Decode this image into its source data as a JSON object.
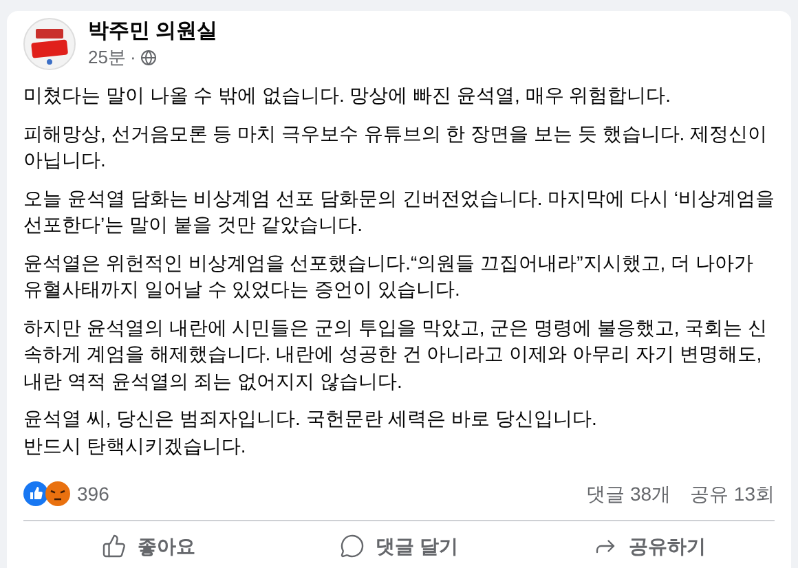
{
  "post": {
    "author": "박주민 의원실",
    "time": "25분",
    "separator": "·",
    "paragraphs": [
      {
        "lines": [
          "미쳤다는 말이 나올 수 밖에 없습니다. 망상에 빠진 윤석열, 매우 위험합니다."
        ]
      },
      {
        "lines": [
          "피해망상, 선거음모론 등 마치 극우보수 유튜브의 한 장면을 보는 듯 했습니다. 제정신이 아닙니다."
        ]
      },
      {
        "lines": [
          "오늘 윤석열 담화는 비상계엄 선포 담화문의 긴버전었습니다. 마지막에 다시 ‘비상계엄을 선포한다’는 말이 붙을 것만 같았습니다."
        ]
      },
      {
        "lines": [
          "윤석열은 위헌적인 비상계엄을 선포했습니다.“의원들 끄집어내라”지시했고, 더 나아가 유혈사태까지 일어날 수 있었다는 증언이 있습니다."
        ]
      },
      {
        "lines": [
          "하지만 윤석열의 내란에 시민들은 군의 투입을 막았고, 군은 명령에 불응했고, 국회는 신속하게 계엄을 해제했습니다. 내란에 성공한 건 아니라고 이제와 아무리 자기 변명해도, 내란 역적 윤석열의 죄는 없어지지 않습니다."
        ]
      },
      {
        "lines": [
          "윤석열 씨, 당신은 범죄자입니다. 국헌문란 세력은 바로 당신입니다.",
          "반드시 탄핵시키겠습니다."
        ]
      }
    ],
    "reactions": {
      "count": "396"
    },
    "comments": "댓글 38개",
    "shares": "공유 13회",
    "actions": [
      {
        "kind": "like",
        "label": "좋아요"
      },
      {
        "kind": "comment",
        "label": "댓글 달기"
      },
      {
        "kind": "share",
        "label": "공유하기"
      }
    ]
  }
}
